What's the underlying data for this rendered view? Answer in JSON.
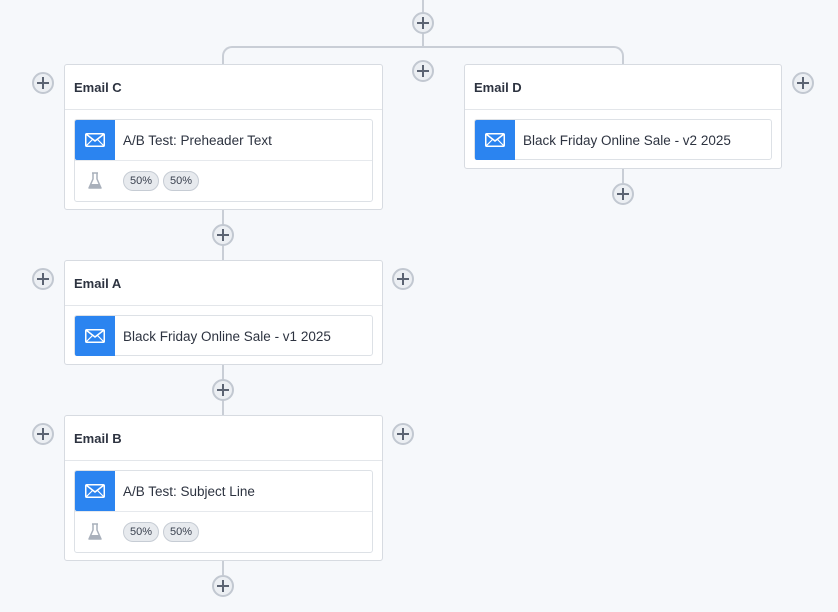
{
  "colors": {
    "canvas_background": "#f6f8fb",
    "connector": "#c9ced6",
    "email_icon_bg": "#2b84f0",
    "card_border": "#d7dbe1"
  },
  "icons": {
    "add": "plus-icon",
    "email": "envelope-icon",
    "ab_test": "flask-icon"
  },
  "nodes": {
    "email_c": {
      "title": "Email C",
      "message_title": "A/B Test: Preheader Text",
      "variants": [
        "50%",
        "50%"
      ]
    },
    "email_d": {
      "title": "Email D",
      "message_title": "Black Friday Online Sale - v2 2025"
    },
    "email_a": {
      "title": "Email A",
      "message_title": "Black Friday Online Sale - v1 2025"
    },
    "email_b": {
      "title": "Email B",
      "message_title": "A/B Test: Subject Line",
      "variants": [
        "50%",
        "50%"
      ]
    }
  }
}
